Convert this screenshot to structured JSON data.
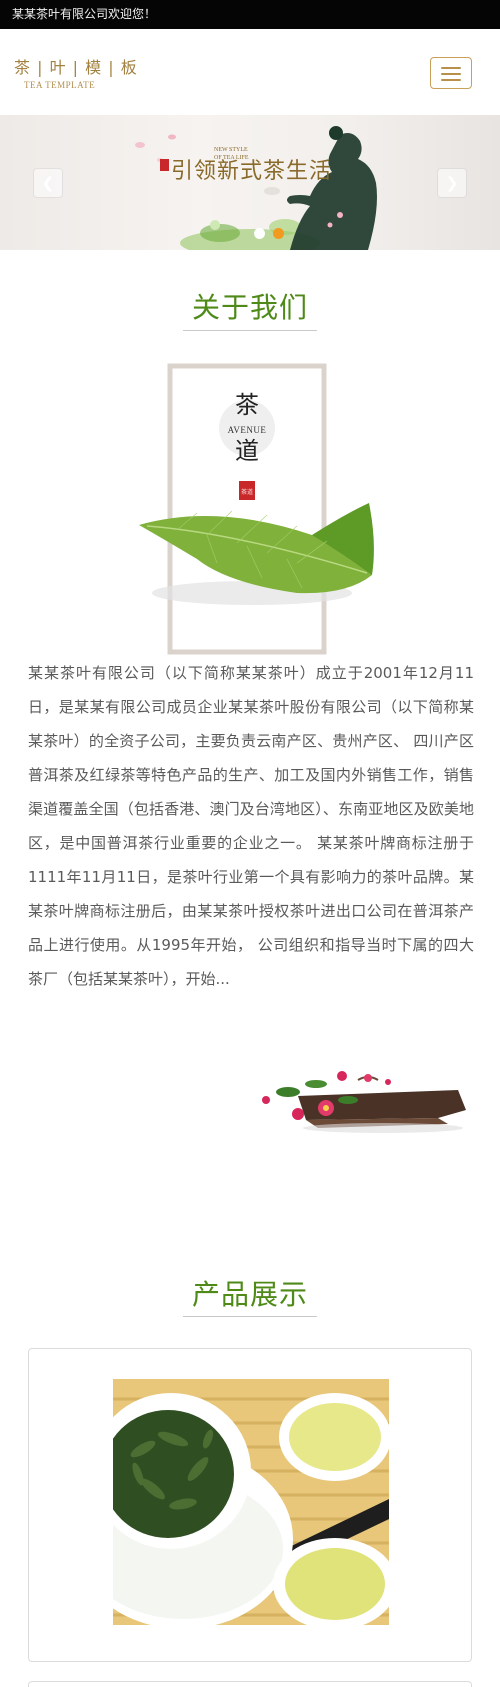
{
  "topbar": {
    "welcome": "某某茶叶有限公司欢迎您！"
  },
  "header": {
    "logo_cn": "茶 | 叶 | 模 | 板",
    "logo_en": "TEA TEMPLATE",
    "menu_icon": "hamburger-menu-icon"
  },
  "banner": {
    "slogan_big": "引领新式茶生活",
    "slogan_en_1": "NEW STYLE",
    "slogan_en_2": "OF TEA LIFE",
    "prev_icon": "chevron-left-icon",
    "next_icon": "chevron-right-icon",
    "slides": [
      {
        "active": false
      },
      {
        "active": true
      }
    ],
    "colors": {
      "dot_inactive": "#ffffff",
      "dot_active": "#f29a1f"
    }
  },
  "about": {
    "title": "关于我们",
    "illustration": {
      "char_1": "茶",
      "char_2": "道",
      "en": "AVENUE",
      "seal": "茶道"
    },
    "text": "某某茶叶有限公司（以下简称某某茶叶）成立于2001年12月11日，是某某有限公司成员企业某某茶叶股份有限公司（以下简称某某茶叶）的全资子公司，主要负责云南产区、贵州产区、 四川产区普洱茶及红绿茶等特色产品的生产、加工及国内外销售工作，销售渠道覆盖全国（包括香港、澳门及台湾地区）、东南亚地区及欧美地区，是中国普洱茶行业重要的企业之一。 某某茶叶牌商标注册于1111年11月11日，是茶叶行业第一个具有影响力的茶叶品牌。某某茶叶牌商标注册后，由某某茶叶授权茶叶进出口公司在普洱茶产品上进行使用。从1995年开始， 公司组织和指导当时下属的四大茶厂（包括某某茶叶），开始..."
  },
  "products": {
    "title": "产品展示"
  },
  "theme": {
    "title_green": "#4f8a19",
    "gold": "#b8904c"
  }
}
